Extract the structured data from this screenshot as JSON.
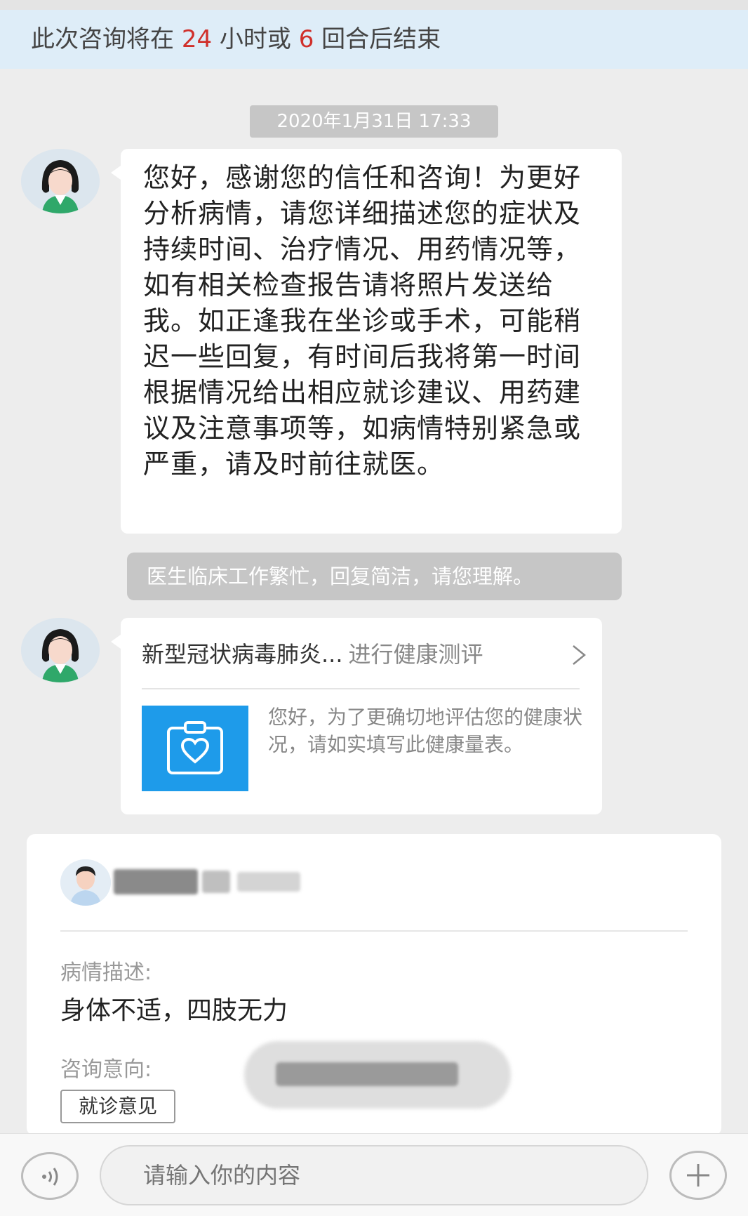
{
  "notice": {
    "prefix": "此次咨询将在 ",
    "hours": "24",
    "mid": " 小时或 ",
    "rounds": "6",
    "suffix": " 回合后结束"
  },
  "chat": {
    "timestamp": "2020年1月31日 17:33",
    "doctor_message": "您好，感谢您的信任和咨询！为更好分析病情，请您详细描述您的症状及持续时间、治疗情况、用药情况等，如有相关检查报告请将照片发送给我。如正逢我在坐诊或手术，可能稍迟一些回复，有时间后我将第一时间根据情况给出相应就诊建议、用药建议及注意事项等，如病情特别紧急或严重，请及时前往就医。",
    "system_note": "医生临床工作繁忙，回复简洁，请您理解。",
    "assessment_card": {
      "title": "新型冠状病毒肺炎...",
      "action": "进行健康测评",
      "description": "您好，为了更确切地评估您的健康状况，请如实填写此健康量表。",
      "thumb_color": "#1e9bea"
    }
  },
  "consult_card": {
    "description_label": "病情描述:",
    "description_value": "身体不适，四肢无力",
    "intent_label": "咨询意向:",
    "intent_tag": "就诊意见"
  },
  "input": {
    "placeholder": "请输入你的内容"
  },
  "colors": {
    "accent_red": "#d0302b",
    "notice_bg": "#deedf8",
    "page_bg": "#ededed"
  }
}
